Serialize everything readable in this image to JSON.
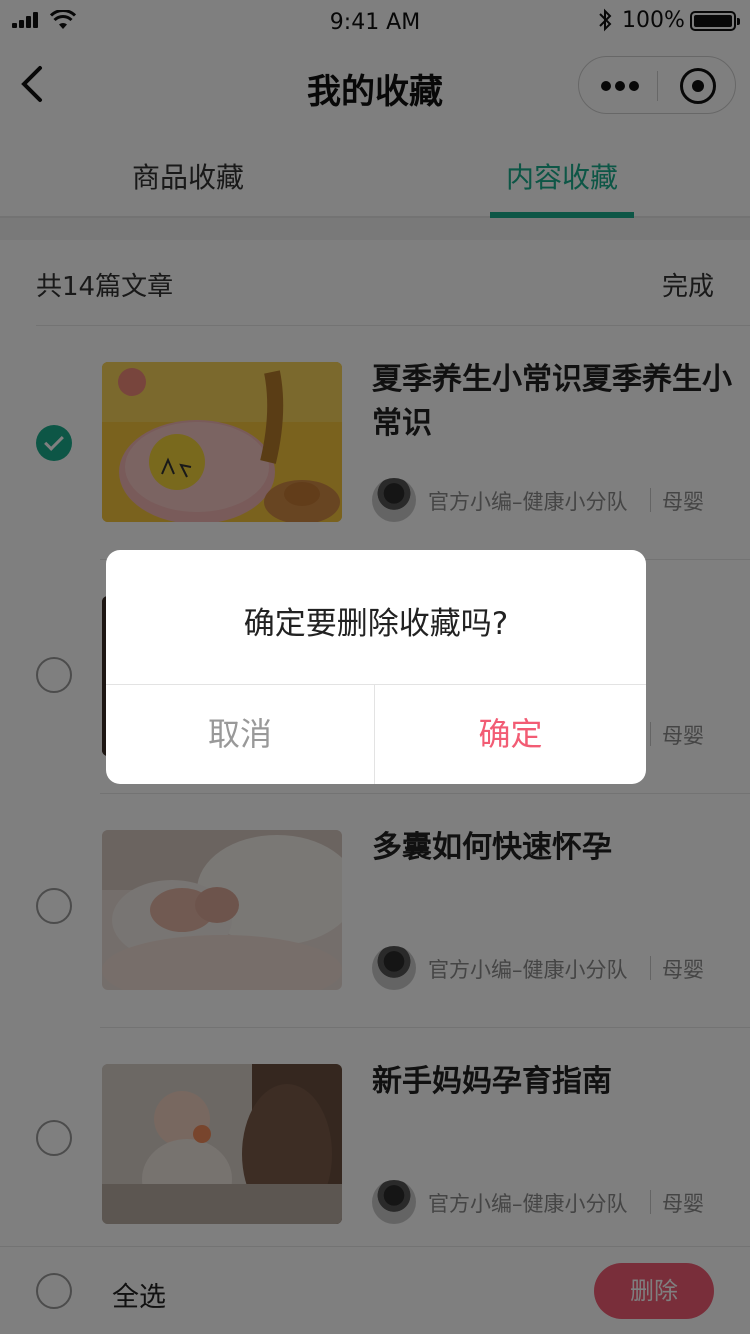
{
  "status_bar": {
    "time": "9:41 AM",
    "battery": "100%"
  },
  "nav": {
    "title": "我的收藏"
  },
  "tabs": [
    {
      "label": "商品收藏",
      "active": false
    },
    {
      "label": "内容收藏",
      "active": true
    }
  ],
  "summary": {
    "count_text": "共14篇文章",
    "done_label": "完成"
  },
  "articles": [
    {
      "title": "夏季养生小常识夏季养生小常识",
      "author": "官方小编–健康小分队",
      "category": "母婴",
      "checked": true
    },
    {
      "title": "",
      "author": "",
      "category": "母婴",
      "checked": false
    },
    {
      "title": "多囊如何快速怀孕",
      "author": "官方小编–健康小分队",
      "category": "母婴",
      "checked": false
    },
    {
      "title": "新手妈妈孕育指南",
      "author": "官方小编–健康小分队",
      "category": "母婴",
      "checked": false
    }
  ],
  "bottom_bar": {
    "select_all_label": "全选",
    "delete_label": "删除"
  },
  "dialog": {
    "message": "确定要删除收藏吗?",
    "cancel_label": "取消",
    "confirm_label": "确定"
  },
  "colors": {
    "accent_green": "#1aad8c",
    "accent_pink": "#f25c74"
  }
}
